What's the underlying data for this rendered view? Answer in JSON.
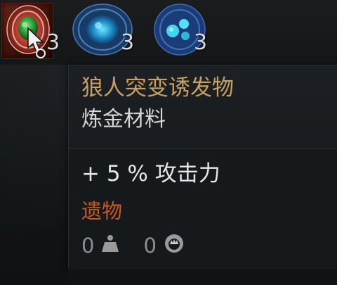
{
  "inventory": {
    "slots": [
      {
        "name": "werewolf-mutagen",
        "quantity": "3",
        "selected": true
      },
      {
        "name": "blue-mutagen",
        "quantity": "3"
      },
      {
        "name": "blue-spotted-mutagen",
        "quantity": "3"
      }
    ]
  },
  "tooltip": {
    "item_name": "狼人突变诱发物",
    "item_type": "炼金材料",
    "stat": "+ 5 %  攻击力",
    "category": "遗物",
    "weight_value": "0",
    "price_value": "0",
    "weight_icon": "weight-icon",
    "price_icon": "crown-coin-icon"
  },
  "colors": {
    "name": "#c8a064",
    "category": "#c65a22",
    "text": "#d6d6d6",
    "muted": "#8e8e8e"
  }
}
